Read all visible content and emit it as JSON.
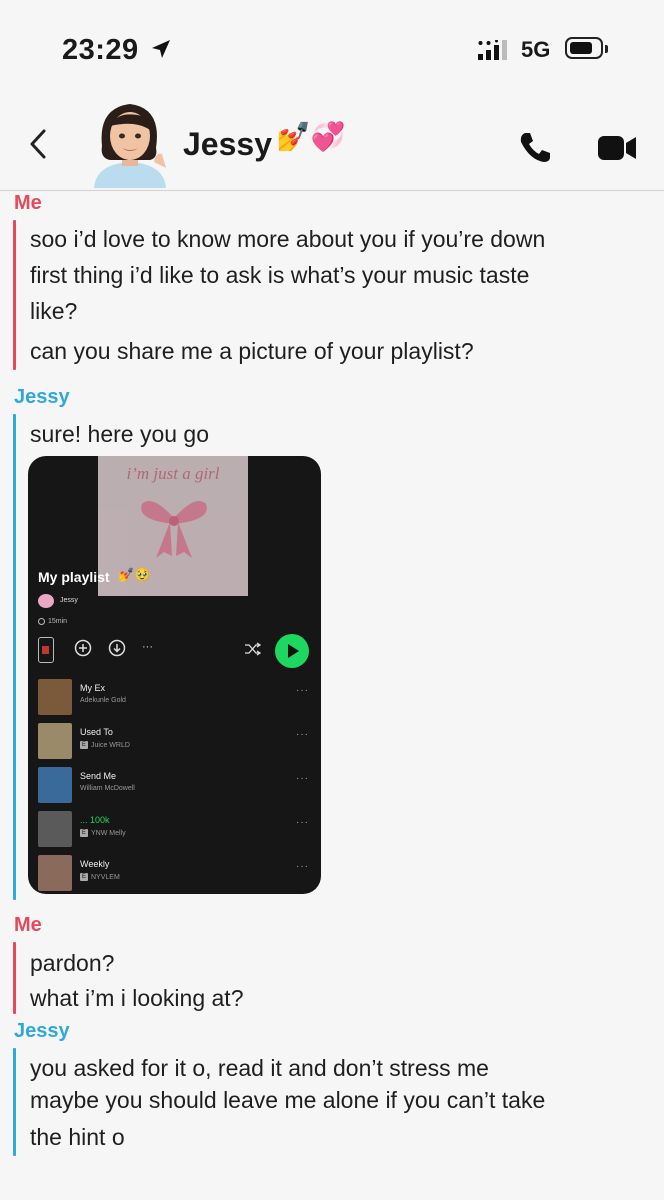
{
  "status_bar": {
    "time": "23:29",
    "network": "5G"
  },
  "header": {
    "contact_name": "Jessy",
    "name_emoji": "💅💞"
  },
  "messages": [
    {
      "sender": "Me",
      "lines": [
        "soo i’d love to know more about you if you’re down",
        "first thing i’d like to ask is what’s your music taste",
        "like?",
        "can you share me a picture of your playlist?"
      ]
    },
    {
      "sender": "Jessy",
      "lines": [
        "sure! here you go"
      ]
    },
    {
      "sender": "Me",
      "lines": [
        "pardon?",
        "what i’m i looking at?"
      ]
    },
    {
      "sender": "Jessy",
      "lines": [
        "you asked for it o, read it and don’t stress me",
        "maybe you should leave me alone if you can’t take",
        "the hint o"
      ]
    }
  ],
  "playlist": {
    "cover_text": "i’m just a girl",
    "title": "My playlist",
    "title_emoji": "💅🥹",
    "owner": "Jessy",
    "duration": "15min",
    "more_label": "···",
    "tracks": [
      {
        "title": "My Ex",
        "artist": "Adekunle Gold",
        "explicit": false,
        "color": "#7a5a3a"
      },
      {
        "title": "Used To",
        "artist": "Juice WRLD",
        "explicit": true,
        "color": "#9a8a6a"
      },
      {
        "title": "Send Me",
        "artist": "William McDowell",
        "explicit": false,
        "color": "#3a6a9a"
      },
      {
        "title": "... 100k",
        "artist": "YNW Melly",
        "explicit": true,
        "color": "#5a5a5a"
      },
      {
        "title": "Weekly",
        "artist": "NYVLEM",
        "explicit": true,
        "color": "#8a6a5a"
      }
    ],
    "track_more": "···",
    "explicit_badge": "E",
    "accent_color": "#1ed760"
  },
  "colors": {
    "me": "#e34b5c",
    "jessy": "#2fa8dc"
  }
}
